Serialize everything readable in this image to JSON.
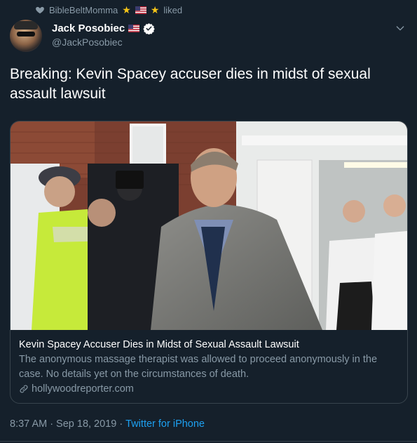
{
  "social_context": {
    "user": "BibleBeltMomma",
    "action": "liked"
  },
  "author": {
    "name": "Jack Posobiec",
    "handle": "@JackPosobiec"
  },
  "tweet": {
    "text": "Breaking: Kevin Spacey accuser dies in midst of sexual assault lawsuit"
  },
  "card": {
    "title": "Kevin Spacey Accuser Dies in Midst of Sexual Assault Lawsuit",
    "description": "The anonymous massage therapist was allowed to proceed anonymously in the case. No details yet on the circumstances of death.",
    "domain": "hollywoodreporter.com"
  },
  "footer": {
    "time": "8:37 AM",
    "separator": "·",
    "date": "Sep 18, 2019",
    "separator2": "·",
    "source": "Twitter for iPhone"
  },
  "colors": {
    "background": "#15202b",
    "secondary_text": "#8899a6",
    "link": "#1da1f2",
    "border": "#38444d"
  },
  "icons": {
    "like": "heart-icon",
    "verified": "verified-badge-icon",
    "more": "chevron-down-icon",
    "link": "link-icon"
  }
}
